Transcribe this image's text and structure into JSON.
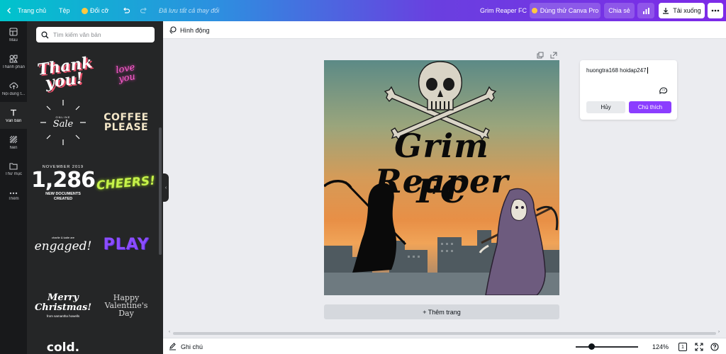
{
  "app": {
    "accent_color": "#8b3dff",
    "topbar_gradient": [
      "#00c4cc",
      "#2d8fe0",
      "#7d2ae8"
    ]
  },
  "topbar": {
    "home_label": "Trang chủ",
    "file_label": "Tệp",
    "resize_label": "Đổi cỡ",
    "saved_status": "Đã lưu tất cả thay đổi",
    "design_title": "Grim Reaper FC",
    "try_pro_label": "Dùng thử Canva Pro",
    "share_label": "Chia sẻ",
    "download_label": "Tải xuống"
  },
  "rail": {
    "items": [
      {
        "label": "Mẫu",
        "icon": "layout-icon"
      },
      {
        "label": "Thành phần",
        "icon": "shapes-icon"
      },
      {
        "label": "Nội dung t...",
        "icon": "upload-cloud-icon"
      },
      {
        "label": "Văn bản",
        "icon": "text-icon",
        "active": true
      },
      {
        "label": "Nền",
        "icon": "background-icon"
      },
      {
        "label": "Thư mục",
        "icon": "folder-icon"
      },
      {
        "label": "Thêm",
        "icon": "more-icon"
      }
    ]
  },
  "panel": {
    "search_placeholder": "Tìm kiếm văn bản",
    "templates": {
      "thank": "Thank you!",
      "love": "love you",
      "sale_top": "ONLINE",
      "sale": "Sale",
      "coffee_line1": "COFFEE",
      "coffee_line2": "PLEASE",
      "nov": "NOVEMBER 2019",
      "big_number": "1,286",
      "newdocs_line1": "NEW DOCUMENTS",
      "newdocs_line2": "CREATED",
      "cheers": "CHEERS!",
      "charlie": "charlie & katie are",
      "engaged": "engaged!",
      "play": "PLAY",
      "merry_line1": "Merry",
      "merry_line2": "Christmas!",
      "merry_from": "from samantha howells",
      "happy_line1": "Happy",
      "happy_line2": "Valentine's Day",
      "cold": "cold."
    }
  },
  "canvas": {
    "animate_label": "Hình động",
    "design_text_line1": "Grim Reaper",
    "design_text_line2": "FC",
    "add_page_label": "+ Thêm trang"
  },
  "comment": {
    "text": "huongtra168 hoidap247",
    "cancel_label": "Hủy",
    "submit_label": "Chú thích"
  },
  "bottombar": {
    "notes_label": "Ghi chú",
    "zoom": "124%",
    "page_count": "1"
  }
}
